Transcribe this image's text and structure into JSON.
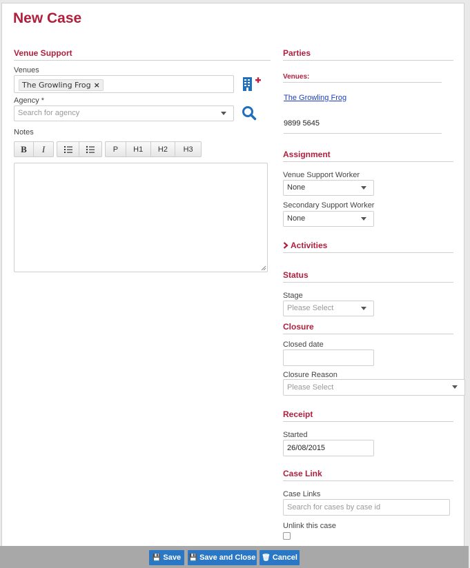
{
  "title": "New Case",
  "venue_support": {
    "heading": "Venue Support",
    "venues_label": "Venues",
    "venue_tag": "The Growling Frog",
    "venue_tag_remove": "×",
    "agency_label": "Agency *",
    "agency_placeholder": "Search for agency",
    "notes_label": "Notes",
    "toolbar": {
      "bold": "B",
      "italic": "I",
      "p": "P",
      "h1": "H1",
      "h2": "H2",
      "h3": "H3"
    },
    "notes_value": ""
  },
  "parties": {
    "heading": "Parties",
    "venues_label": "Venues:",
    "venue_link": "The Growling Frog",
    "phone": "9899 5645"
  },
  "assignment": {
    "heading": "Assignment",
    "vsw_label": "Venue Support Worker",
    "vsw_value": "None",
    "ssw_label": "Secondary Support Worker",
    "ssw_value": "None"
  },
  "activities": {
    "heading": "Activities"
  },
  "status": {
    "heading": "Status",
    "stage_label": "Stage",
    "stage_placeholder": "Please Select"
  },
  "closure": {
    "heading": "Closure",
    "closed_date_label": "Closed date",
    "closed_date_value": "",
    "reason_label": "Closure Reason",
    "reason_placeholder": "Please Select"
  },
  "receipt": {
    "heading": "Receipt",
    "started_label": "Started",
    "started_value": "26/08/2015"
  },
  "case_link": {
    "heading": "Case Link",
    "links_label": "Case Links",
    "links_placeholder": "Search for cases by case id",
    "unlink_label": "Unlink this case"
  },
  "footer": {
    "save": "Save",
    "save_close": "Save and Close",
    "cancel": "Cancel"
  },
  "colors": {
    "accent": "#b0203d",
    "primary_button": "#2a78c5",
    "icon_blue": "#1f6fbf"
  }
}
